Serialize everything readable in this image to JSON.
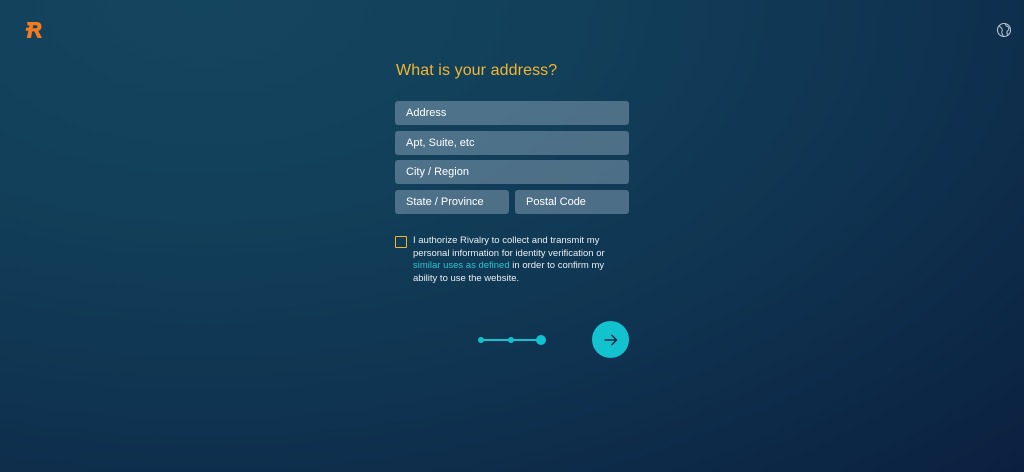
{
  "brand": {
    "accent": "#f47a20",
    "logo_icon": "rivalry-r-logo"
  },
  "header": {
    "language_icon": "globe-icon"
  },
  "form": {
    "title": "What is your address?",
    "address_placeholder": "Address",
    "apt_placeholder": "Apt, Suite, etc",
    "city_placeholder": "City / Region",
    "state_placeholder": "State / Province",
    "postal_placeholder": "Postal Code",
    "consent_before": "I authorize Rivalry to collect and transmit my personal information for identity verification or ",
    "consent_link": "similar uses as defined",
    "consent_after": " in order to confirm my ability to use the website.",
    "consent_checked": false
  },
  "progress": {
    "current_step": 3,
    "total_steps": 3
  },
  "colors": {
    "title": "#f2b630",
    "field_bg": "rgba(150,175,195,0.45)",
    "link": "#2ec4d0",
    "button": "#12c3cf"
  },
  "next_button": {
    "icon": "arrow-right-icon"
  }
}
